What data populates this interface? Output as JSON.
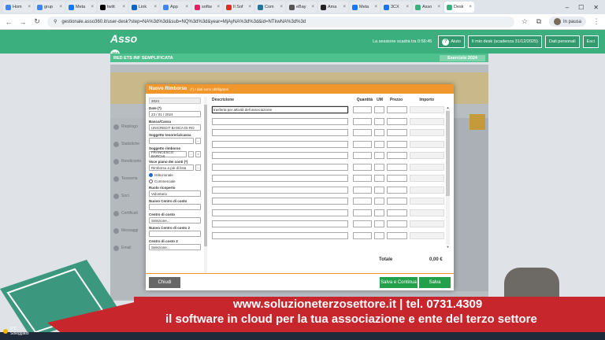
{
  "browser": {
    "tabs": [
      {
        "label": "Hom",
        "color": "#4285f4"
      },
      {
        "label": "grup",
        "color": "#4285f4"
      },
      {
        "label": "Meta",
        "color": "#1877f2"
      },
      {
        "label": "twitt",
        "color": "#000000"
      },
      {
        "label": "Link",
        "color": "#0a66c2"
      },
      {
        "label": "App",
        "color": "#4285f4"
      },
      {
        "label": "softw",
        "color": "#e91e63"
      },
      {
        "label": "Il Sof",
        "color": "#d93025"
      },
      {
        "label": "Com",
        "color": "#21759b"
      },
      {
        "label": "eBay",
        "color": "#555555"
      },
      {
        "label": "Ama",
        "color": "#222222"
      },
      {
        "label": "Meta",
        "color": "#1877f2"
      },
      {
        "label": "3CX",
        "color": "#1a73e8"
      },
      {
        "label": "Asso",
        "color": "#3bb07e"
      },
      {
        "label": "Desk",
        "color": "#3bb07e"
      }
    ],
    "url": "gestionale.asso360.it/user-desk?step=NA%3d%3d&sub=NQ%3d%3d&year=MjAyNA%3d%3d&id=NTkwNA%3d%3d",
    "pause_label": "In pausa"
  },
  "header": {
    "logo_text": "Asso",
    "logo_badge": "360",
    "expiry_text": "La sessione scadrà tra 0:56:45",
    "aiuto_label": "Aiuto",
    "desk_label": "Il mio desk (scadenza 31/12/2025)",
    "dati_label": "Dati personali",
    "esci_label": "Esci",
    "subbar_left": "RED ETS INF SEMPLIFICATA",
    "subbar_right": "Esercizio 2024"
  },
  "bg_side": [
    "Riepilogo",
    "Statistiche",
    "Rendiconto",
    "Tesoreria",
    "Soci",
    "Certificati",
    "Messaggi",
    "Email"
  ],
  "modal": {
    "title": "Nuovo Rimborso",
    "subtitle": "(*) I dati sono obbligatori",
    "left": {
      "year": "2024",
      "date_label": "Date (*)",
      "date_value": "23 / 01 / 2024",
      "bank_label": "Banca/Cassa",
      "bank_value": "UNICREDIT BANCA DI RO",
      "tesoriere_label": "Soggetto tesoreria/cassa",
      "tesoriere_value": "",
      "rimborso_label": "Soggetto rimborso",
      "rimborso_value": "FRANCESCO BARCHI",
      "voce_label": "Voce piano dei conti (*)",
      "voce_value": "Rimborso a piè di lista",
      "radio1": "Istituzionale",
      "radio2": "Commerciale",
      "ruolo_label": "Ruolo ricoperto",
      "ruolo_value": "Volontario",
      "centro_label": "Nuovo Centro di costo",
      "centro_value": "",
      "centro2_label": "Centro di costo",
      "centro2_value": "Selezione...",
      "centro3_label": "Nuovo Centro di costo 2",
      "centro3_value": "",
      "centro4_label": "Centro di costo 2",
      "centro4_value": "Selezione..."
    },
    "grid": {
      "headers": {
        "desc": "Descrizione",
        "qty": "Quantità",
        "um": "UM",
        "price": "Prezzo",
        "amount": "Importo"
      },
      "first_desc": "trasferta per attività dell associazione",
      "rows": 12
    },
    "totale_label": "Totale",
    "totale_value": "0,00 €",
    "close_label": "Chiudi",
    "save_continue_label": "Salva e Continua",
    "save_label": "Salva"
  },
  "promo": {
    "line1": "www.soluzioneterzosettore.it | tel. 0731.4309",
    "line2": "il software in cloud per la tua associazione e ente del terzo settore"
  },
  "weather": {
    "temp": "8°C",
    "desc": "Soleggiato"
  }
}
